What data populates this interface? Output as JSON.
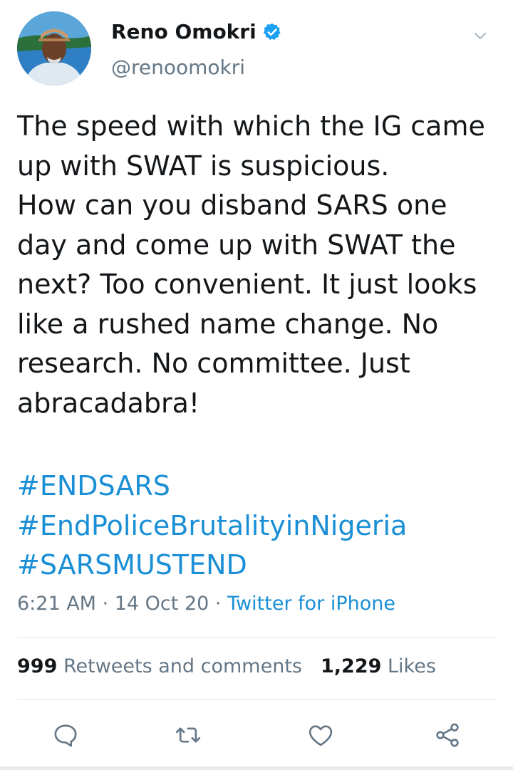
{
  "user": {
    "name": "Reno Omokri",
    "handle": "@renoomokri",
    "verified": true
  },
  "tweet": {
    "text": "The speed with which the IG came\nup with SWAT is suspicious.\nHow can you disband SARS one\nday and come up with SWAT the\nnext? Too convenient. It just looks\nlike a rushed name change. No\nresearch. No committee. Just\nabracadabra!",
    "hashtags": [
      "#ENDSARS",
      "#EndPoliceBrutalityinNigeria",
      "#SARSMUSTEND"
    ],
    "time": "6:21 AM",
    "date": "14 Oct 20",
    "source": "Twitter for iPhone",
    "separator": " · "
  },
  "stats": {
    "retweets_count": "999",
    "retweets_label": "Retweets and comments",
    "likes_count": "1,229",
    "likes_label": "Likes"
  },
  "colors": {
    "link": "#1a8fd6",
    "text": "#14171a",
    "muted": "#657786",
    "verified": "#1da1f2"
  },
  "icons": {
    "reply": "reply-icon",
    "retweet": "retweet-icon",
    "like": "like-icon",
    "share": "share-icon",
    "menu": "chevron-down-icon",
    "verified": "verified-badge-icon"
  }
}
